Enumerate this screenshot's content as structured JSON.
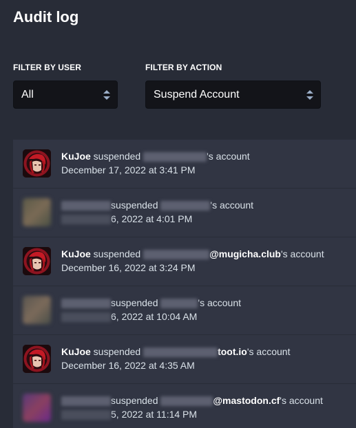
{
  "page": {
    "title": "Audit log"
  },
  "filters": {
    "user": {
      "label": "FILTER BY USER",
      "value": "All"
    },
    "action": {
      "label": "FILTER BY ACTION",
      "value": "Suspend Account"
    }
  },
  "icons": {
    "select_arrows": "up-down-chevrons-icon",
    "avatar": "anime-avatar-red"
  },
  "colors": {
    "background": "#282c37",
    "row": "#313543",
    "select": "#131419"
  },
  "entries": [
    {
      "actor": "KuJoe",
      "verb": " suspended ",
      "domain": "",
      "suffix": "'s account",
      "timestamp": "December 17, 2022 at 3:41 PM"
    },
    {
      "actor": "",
      "verb": "suspended ",
      "domain": "",
      "suffix": "'s account",
      "timestamp": "6, 2022 at 4:01 PM"
    },
    {
      "actor": "KuJoe",
      "verb": " suspended ",
      "domain": "@mugicha.club",
      "suffix": "'s account",
      "timestamp": "December 16, 2022 at 3:24 PM"
    },
    {
      "actor": "",
      "verb": "suspended ",
      "domain": "",
      "suffix": "'s account",
      "timestamp": "6, 2022 at 10:04 AM"
    },
    {
      "actor": "KuJoe",
      "verb": " suspended ",
      "domain": "toot.io",
      "suffix": "'s account",
      "timestamp": "December 16, 2022 at 4:35 AM"
    },
    {
      "actor": "",
      "verb": "suspended ",
      "domain": "@mastodon.cf",
      "suffix": "'s account",
      "timestamp": "5, 2022 at 11:14 PM"
    }
  ]
}
